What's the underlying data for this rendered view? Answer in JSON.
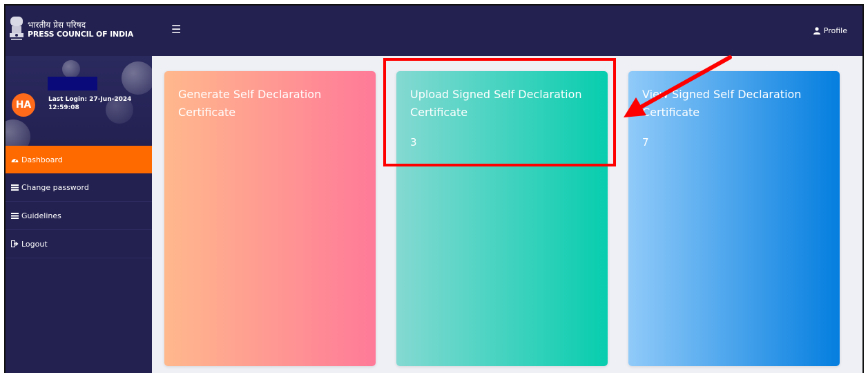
{
  "header": {
    "logo_hindi": "भारतीय प्रेस परिषद",
    "logo_english": "PRESS COUNCIL OF INDIA",
    "menu_icon": "hamburger-icon",
    "profile_label": "Profile",
    "profile_icon": "user-icon"
  },
  "user": {
    "initials": "HA",
    "last_login_label": "Last Login: 27-Jun-2024",
    "last_login_time": "12:59:08"
  },
  "sidebar": {
    "items": [
      {
        "label": "Dashboard",
        "icon": "dashboard-icon",
        "active": true
      },
      {
        "label": "Change password",
        "icon": "list-icon",
        "active": false
      },
      {
        "label": "Guidelines",
        "icon": "list-icon",
        "active": false
      },
      {
        "label": "Logout",
        "icon": "logout-icon",
        "active": false
      }
    ]
  },
  "cards": [
    {
      "title": "Generate Self Declaration Certificate",
      "count": ""
    },
    {
      "title": "Upload Signed Self Declaration Certificate",
      "count": "3"
    },
    {
      "title": "View Signed Self Declaration Certificate",
      "count": "7"
    }
  ],
  "colors": {
    "navy": "#232150",
    "accent": "#ff6a00",
    "annotation": "#ff0000"
  }
}
